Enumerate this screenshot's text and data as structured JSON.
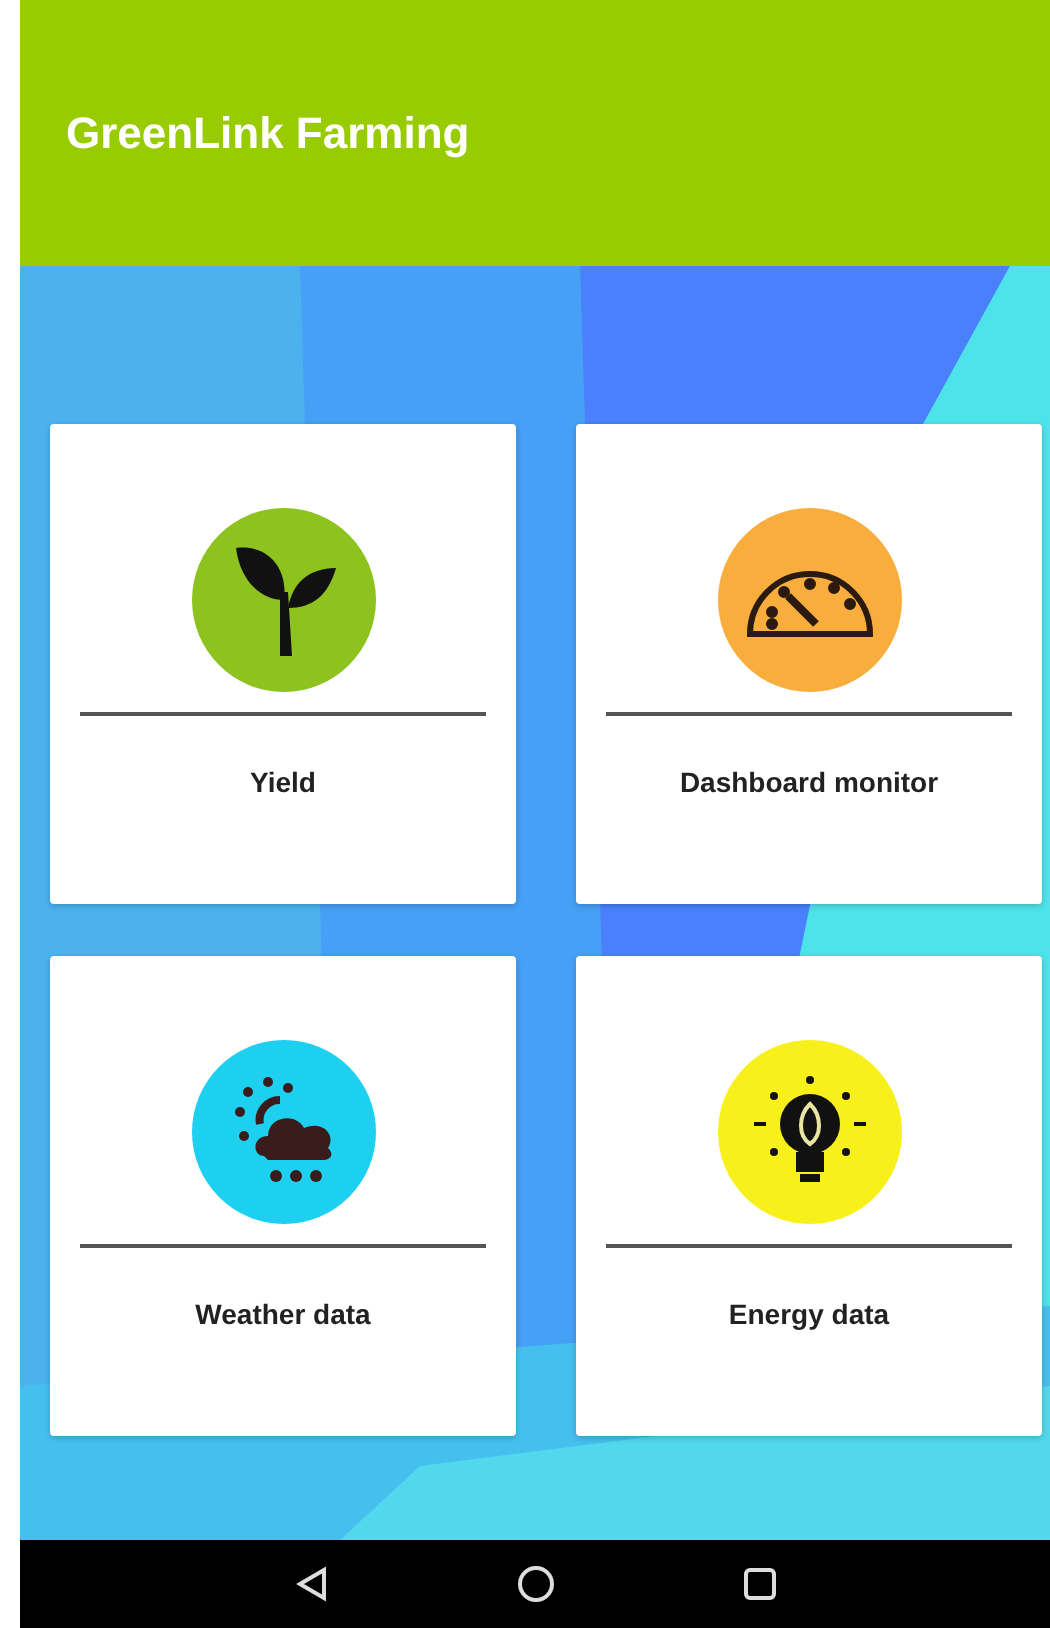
{
  "app_bar": {
    "title": "GreenLink Farming"
  },
  "tiles": [
    {
      "label": "Yield",
      "kind": "sprout",
      "color": "#8dc21f"
    },
    {
      "label": "Dashboard monitor",
      "kind": "gauge",
      "color": "#f8ad3c"
    },
    {
      "label": "Weather data",
      "kind": "weather",
      "color": "#1ed0ef"
    },
    {
      "label": "Energy data",
      "kind": "bulb",
      "color": "#f7f01b"
    }
  ]
}
